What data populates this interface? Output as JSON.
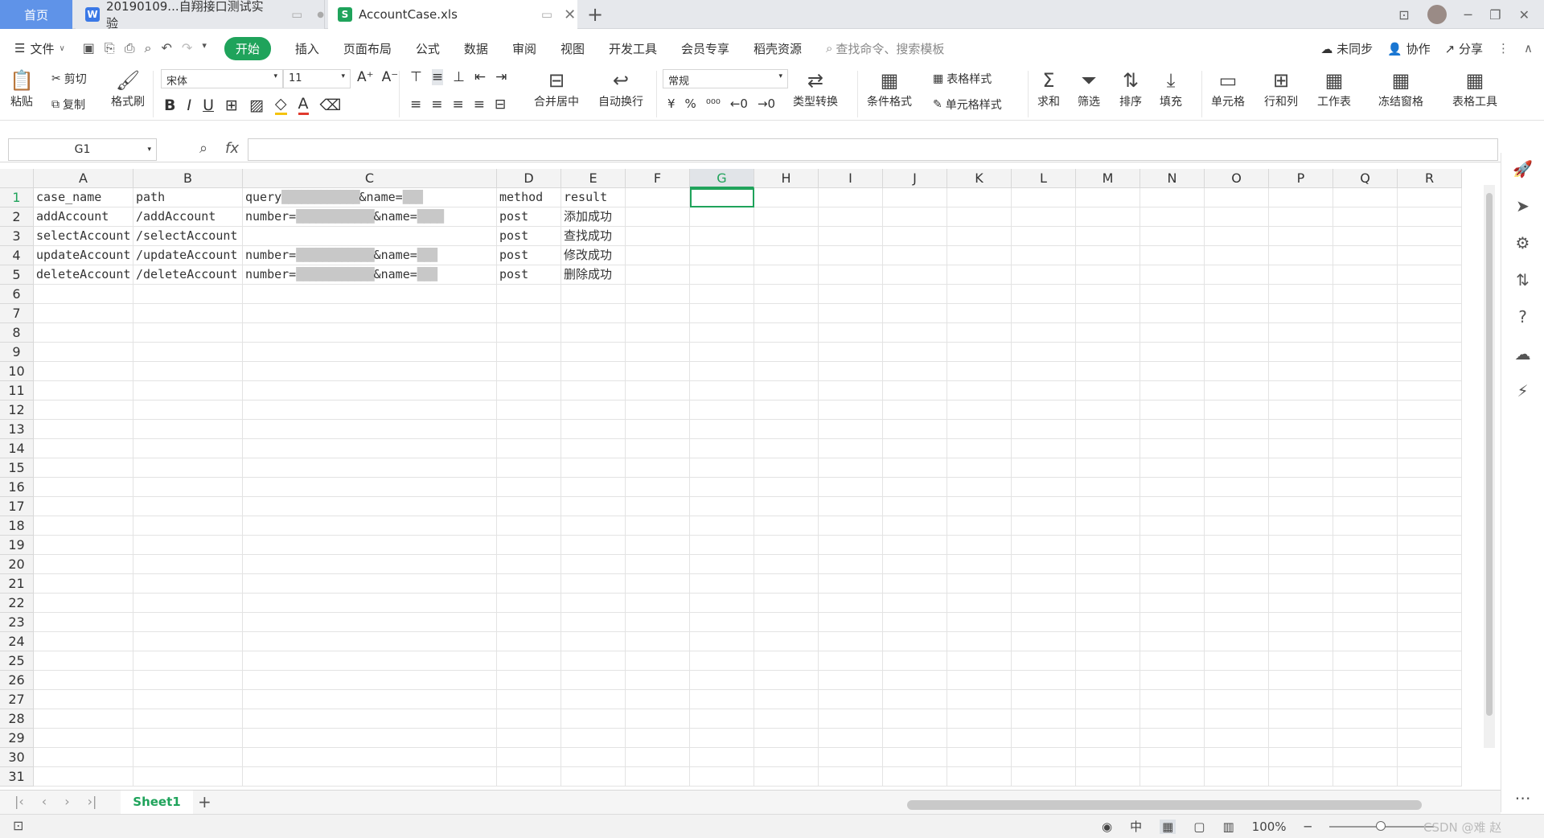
{
  "tabs": {
    "home": "首页",
    "doc": "20190109...自翔接口测试实验",
    "xls": "AccountCase.xls",
    "doc_icon": "W",
    "xls_icon": "S"
  },
  "menu": {
    "file": "文件",
    "items": [
      "开始",
      "插入",
      "页面布局",
      "公式",
      "数据",
      "审阅",
      "视图",
      "开发工具",
      "会员专享",
      "稻壳资源"
    ],
    "search_placeholder": "查找命令、搜索模板",
    "sync": "未同步",
    "collab": "协作",
    "share": "分享"
  },
  "ribbon": {
    "paste": "粘贴",
    "cut": "剪切",
    "copy": "复制",
    "format_painter": "格式刷",
    "font": "宋体",
    "font_size": "11",
    "number_format": "常规",
    "merge": "合并居中",
    "wrap": "自动换行",
    "convert": "类型转换",
    "cond_format": "条件格式",
    "table_style": "表格样式",
    "cell_style": "单元格样式",
    "sum": "求和",
    "filter": "筛选",
    "sort": "排序",
    "fill": "填充",
    "cell": "单元格",
    "rowcol": "行和列",
    "sheet": "工作表",
    "freeze": "冻结窗格",
    "tools": "表格工具"
  },
  "namebox": "G1",
  "fx": "fx",
  "columns": [
    "A",
    "B",
    "C",
    "D",
    "E",
    "F",
    "G",
    "H",
    "I",
    "J",
    "K",
    "L",
    "M",
    "N",
    "O",
    "P",
    "Q",
    "R"
  ],
  "rows": [
    [
      "case_name",
      "path",
      "query",
      "method",
      "result"
    ],
    [
      "addAccount",
      "/addAccount",
      "number=",
      "post",
      "添加成功"
    ],
    [
      "selectAccount",
      "/selectAccount",
      "",
      "post",
      "查找成功"
    ],
    [
      "updateAccount",
      "/updateAccount",
      "number=",
      "post",
      "修改成功"
    ],
    [
      "deleteAccount",
      "/deleteAccount",
      "number=",
      "post",
      "删除成功"
    ]
  ],
  "query_suffix": "&name=",
  "sheet": {
    "name": "Sheet1"
  },
  "status": {
    "zoom": "100%",
    "watermark": "CSDN @难 赵"
  }
}
